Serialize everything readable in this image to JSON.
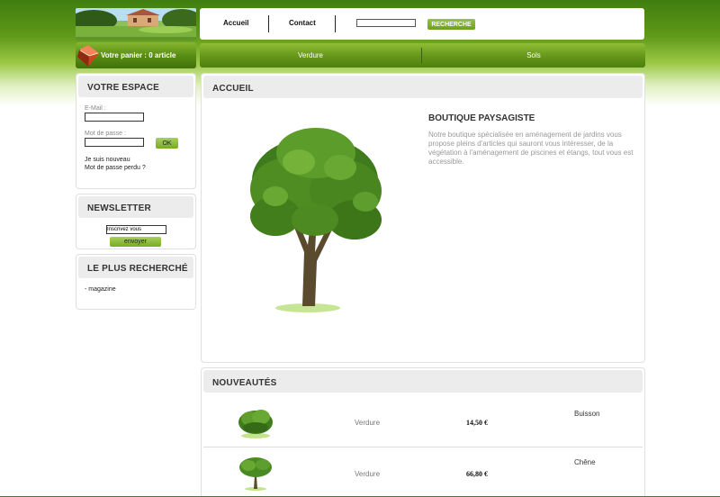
{
  "cart": {
    "label": "Votre panier : 0 article"
  },
  "topnav": {
    "home": "Accueil",
    "contact": "Contact",
    "search_value": "",
    "search_button": "RECHERCHE"
  },
  "categories": [
    "Verdure",
    "Sols"
  ],
  "account": {
    "title": "VOTRE ESPACE",
    "email_label": "E-Mail :",
    "password_label": "Mot de passe :",
    "ok_button": "OK",
    "register_link": "Je suis nouveau",
    "lost_password_link": "Mot de passe perdu ?"
  },
  "newsletter": {
    "title": "NEWSLETTER",
    "input_value": "Inscrivez vous",
    "submit_button": "envoyer"
  },
  "popular": {
    "title": "LE PLUS RECHERCHÉ",
    "items": [
      "- magazine"
    ]
  },
  "home": {
    "title": "ACCUEIL",
    "shop_title": "BOUTIQUE PAYSAGISTE",
    "shop_description": "Notre boutique spécialisée en aménagement de jardins vous propose pleins d'articles qui sauront vous intéresser, de la végétation à l'aménagement de piscines et étangs, tout vous est accessible."
  },
  "new_products": {
    "title": "NOUVEAUTÉS",
    "rows": [
      {
        "category": "Verdure",
        "price": "14,50 €",
        "name": "Buisson"
      },
      {
        "category": "Verdure",
        "price": "66,80 €",
        "name": "Chêne"
      }
    ]
  },
  "colors": {
    "brand_green": "#6e9f1c",
    "panel_grey": "#ececec"
  }
}
